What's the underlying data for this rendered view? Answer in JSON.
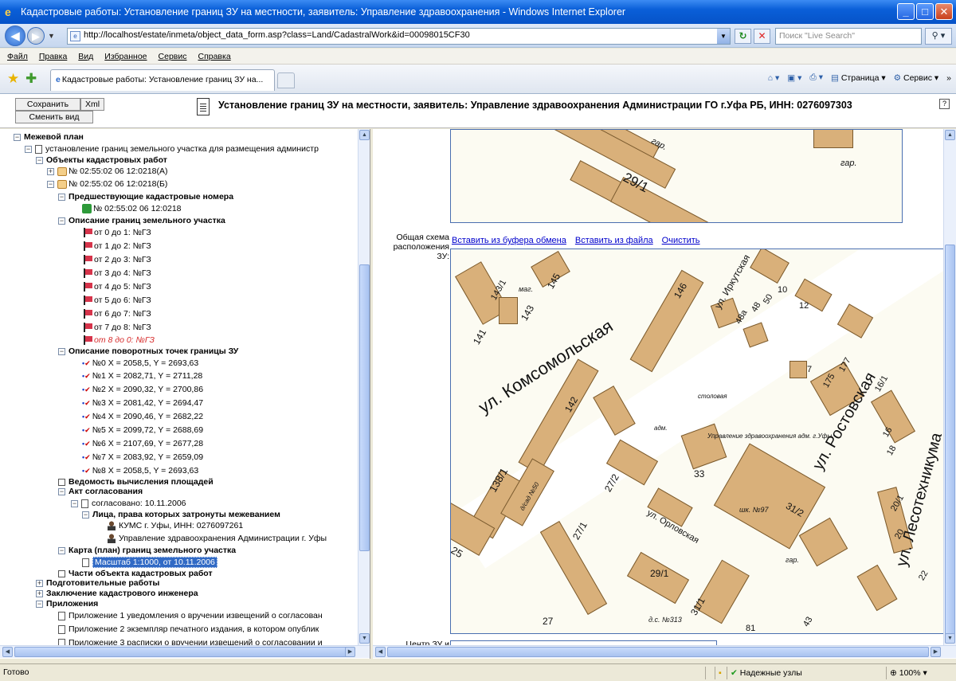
{
  "window": {
    "title": "Кадастровые работы: Установление границ ЗУ на местности, заявитель: Управление здравоохранения  - Windows Internet Explorer",
    "min": "_",
    "max": "□",
    "close": "✕"
  },
  "address": {
    "url": "http://localhost/estate/inmeta/object_data_form.asp?class=Land/CadastralWork&id=00098015CF30",
    "search_placeholder": "Поиск \"Live Search\""
  },
  "menu": [
    "Файл",
    "Правка",
    "Вид",
    "Избранное",
    "Сервис",
    "Справка"
  ],
  "tab": {
    "label": "Кадастровые работы: Установление границ ЗУ на..."
  },
  "commands": {
    "page": "Страница",
    "tools": "Сервис"
  },
  "app": {
    "save_button": "Сохранить",
    "xml_button": "Xml",
    "change_view_button": "Сменить вид",
    "title": "Установление границ ЗУ на местности, заявитель: Управление здравоохранения Администрации ГО г.Уфа РБ, ИНН: 0276097303"
  },
  "tree": {
    "mezhevoy_plan": "Межевой план",
    "ustanovlenie": "установление границ земельного участка для размещения администр",
    "objects": "Объекты кадастровых работ",
    "obj_a": "№ 02:55:02 06 12:0218(А)",
    "obj_b": "№ 02:55:02 06 12:0218(Б)",
    "prev_numbers": "Предшествующие кадастровые номера",
    "prev_num_item": "№ 02:55:02 06 12:0218",
    "borders_desc": "Описание границ земельного участка",
    "segments": [
      "от 0 до 1: №ГЗ",
      "от 1 до 2: №ГЗ",
      "от 2 до 3: №ГЗ",
      "от 3 до 4: №ГЗ",
      "от 4 до 5: №ГЗ",
      "от 5 до 6: №ГЗ",
      "от 6 до 7: №ГЗ",
      "от 7 до 8: №ГЗ",
      "от 8 до 0: №ГЗ"
    ],
    "points_desc": "Описание поворотных точек границы ЗУ",
    "points": [
      "№0 X = 2058,5, Y = 2693,63",
      "№1 X = 2082,71, Y = 2711,28",
      "№2 X = 2090,32, Y = 2700,86",
      "№3 X = 2081,42, Y = 2694,47",
      "№4 X = 2090,46, Y = 2682,22",
      "№5 X = 2099,72, Y = 2688,69",
      "№6 X = 2107,69, Y = 2677,28",
      "№7 X = 2083,92, Y = 2659,09",
      "№8 X = 2058,5, Y = 2693,63"
    ],
    "area_sheet": "Ведомость вычисления площадей",
    "act": "Акт согласования",
    "agreed": "согласовано: 10.11.2006",
    "persons": "Лица, права которых затронуты межеванием",
    "person1": "КУМС г. Уфы, ИНН: 0276097261",
    "person2": "Управление здравоохранения Администрации г. Уфы",
    "map_plan": "Карта (план) границ земельного участка",
    "scale": "Масштаб 1:1000, от 10.11.2006",
    "parts": "Части объекта кадастровых работ",
    "prep": "Подготовительные работы",
    "conclusion": "Заключение кадастрового инженера",
    "appendices": "Приложения",
    "app1": "Приложение 1 уведомления о вручении извещений о согласован",
    "app2": "Приложение 2 экземпляр печатного издания, в котором опублик",
    "app3": "Приложение 3 расписки о вручении извещений о согласовании и"
  },
  "content": {
    "field_label_1": "Общая схема",
    "field_label_2": "расположения",
    "field_label_3": "ЗУ:",
    "paste_clipboard": "Вставить из буфера обмена",
    "paste_file": "Вставить из файла",
    "clear": "Очистить",
    "cut_label": "Центр ЗУ и"
  },
  "map_labels": {
    "gar1": "гар.",
    "gar2": "гар.",
    "n29_1": "29/1",
    "komsomolskaya": "ул. Комсомольская",
    "rostovskaya": "ул. Ростовская",
    "lesotekhnikuma": "ул. Лесотехникума",
    "irkutskaya": "ул. Иркутская",
    "orlovskaya": "ул. Орловская",
    "n146": "146",
    "n142": "142",
    "n141": "141",
    "n143": "143",
    "n145": "145",
    "n143_1": "143/1",
    "mag": "маг.",
    "n138_1": "138/1",
    "n27_2": "27/2",
    "n27_1": "27/1",
    "n29_1b": "29/1",
    "n31_1": "31/1",
    "n31_2": "31/2",
    "n33": "33",
    "n25": "25",
    "n27": "27",
    "n10": "10",
    "n12": "12",
    "n48a": "48а",
    "n48": "48",
    "n50": "50",
    "n175": "175",
    "n177": "177",
    "n7": "7",
    "n16_1": "16/1",
    "n16": "16",
    "n18": "18",
    "n20_1": "20/1",
    "n20": "20",
    "n22": "22",
    "n81": "81",
    "n43": "43",
    "school": "шк. №97",
    "stolovaya": "столовая",
    "adm": "адм.",
    "uprav": "Управление здравоохранения адм. г.Уфы",
    "ds": "д.с. №313",
    "dsad": "д/сад №50",
    "gar3": "гар."
  },
  "status": {
    "ready": "Готово",
    "zone": "Надежные узлы",
    "zoom": "100%"
  }
}
